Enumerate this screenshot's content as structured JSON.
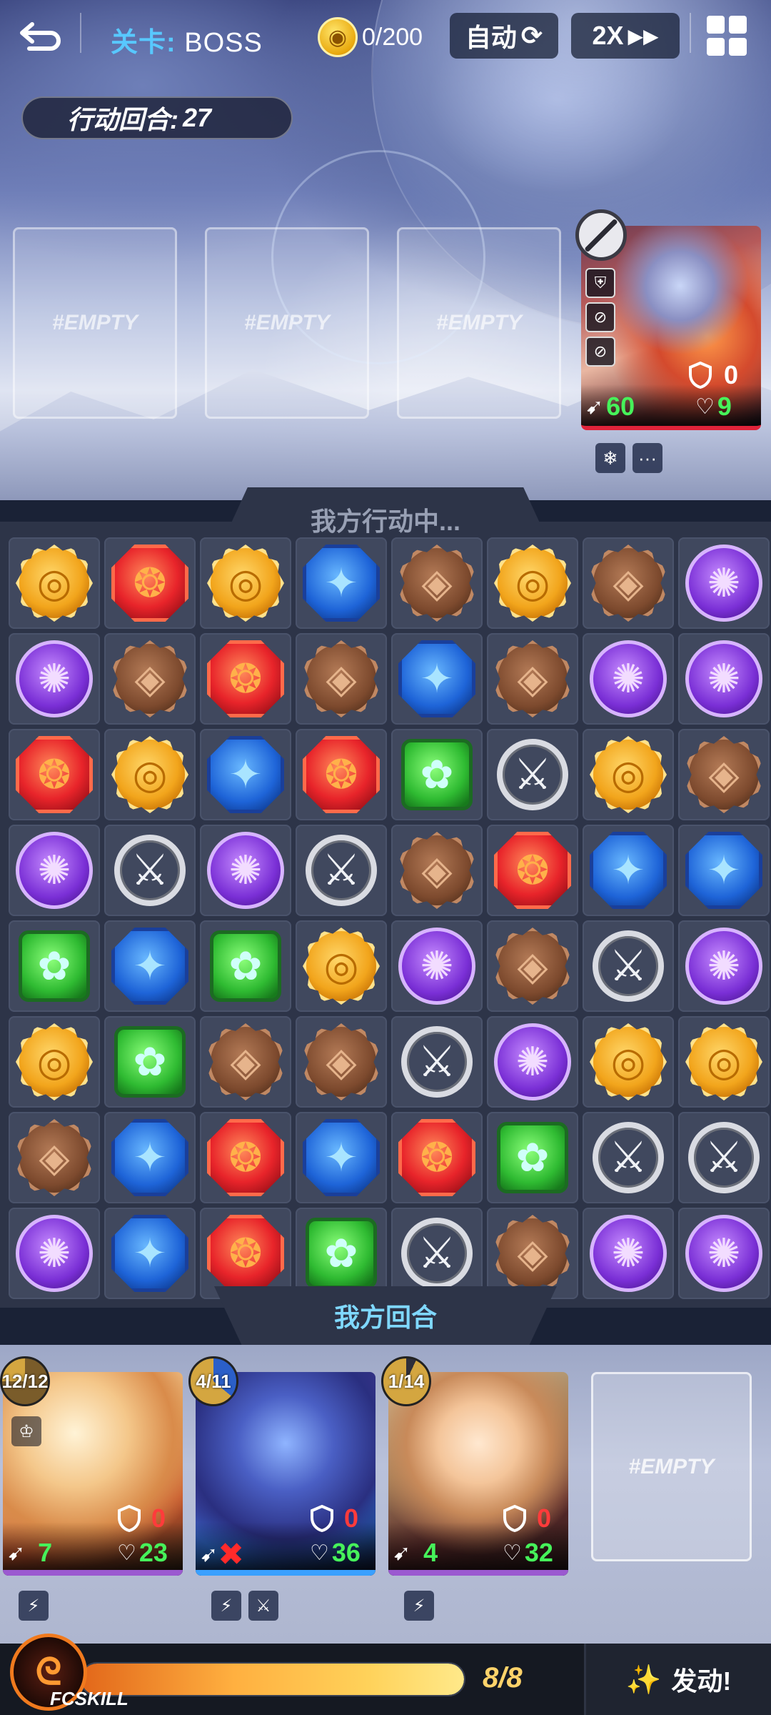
{
  "topbar": {
    "back_icon": "back-arrow-icon",
    "stage_key": "关卡:",
    "stage_value": "BOSS",
    "coin_text": "0/200",
    "auto_label": "自动",
    "speed_label": "2X",
    "menu_icon": "grid-menu-icon"
  },
  "turn": {
    "label": "行动回合:",
    "value": "27"
  },
  "enemy_slots": [
    "#EMPTY",
    "#EMPTY",
    "#EMPTY"
  ],
  "boss": {
    "shield": "0",
    "attack": "60",
    "hp": "9",
    "status_icons": [
      "no-attack-icon",
      "shield-status-icon",
      "no-skill-icon",
      "no-move-icon"
    ],
    "extra_icons": [
      "snowflake-icon",
      "chat-icon"
    ]
  },
  "board": {
    "header": "我方行动中...",
    "footer": "我方回合",
    "rows": [
      [
        "sun",
        "fire",
        "sun",
        "water",
        "earth",
        "sun",
        "earth",
        "dark"
      ],
      [
        "dark",
        "earth",
        "fire",
        "earth",
        "water",
        "earth",
        "dark",
        "dark"
      ],
      [
        "fire",
        "sun",
        "water",
        "fire",
        "nature",
        "sword",
        "sun",
        "earth"
      ],
      [
        "dark",
        "sword",
        "dark",
        "sword",
        "earth",
        "fire",
        "water",
        "water"
      ],
      [
        "nature",
        "water",
        "nature",
        "sun",
        "dark",
        "earth",
        "sword",
        "dark"
      ],
      [
        "sun",
        "nature",
        "earth",
        "earth",
        "sword",
        "dark",
        "sun",
        "sun"
      ],
      [
        "earth",
        "water",
        "fire",
        "water",
        "fire",
        "nature",
        "sword",
        "sword"
      ],
      [
        "dark",
        "water",
        "fire",
        "nature",
        "sword",
        "earth",
        "dark",
        "dark"
      ]
    ]
  },
  "heroes": [
    {
      "cooldown": "12/12",
      "shield": "0",
      "attack": "7",
      "hp": "23",
      "accent": "#9b59d0"
    },
    {
      "cooldown": "4/11",
      "shield": "0",
      "attack": "",
      "hp": "36",
      "accent": "#3aa0ff"
    },
    {
      "cooldown": "1/14",
      "shield": "0",
      "attack": "4",
      "hp": "32",
      "accent": "#9b59d0"
    }
  ],
  "empty_slot": "#EMPTY",
  "skill": {
    "label": "FCSKILL",
    "energy": "8/8",
    "progress": 1.0,
    "fire_label": "发动!"
  },
  "colors": {
    "accent_blue": "#58c8ff",
    "stat_green": "#46f25a",
    "stat_red": "#ff3b3b",
    "boss_bar": "#e0233a",
    "skill_orange": "#f07a1e"
  }
}
